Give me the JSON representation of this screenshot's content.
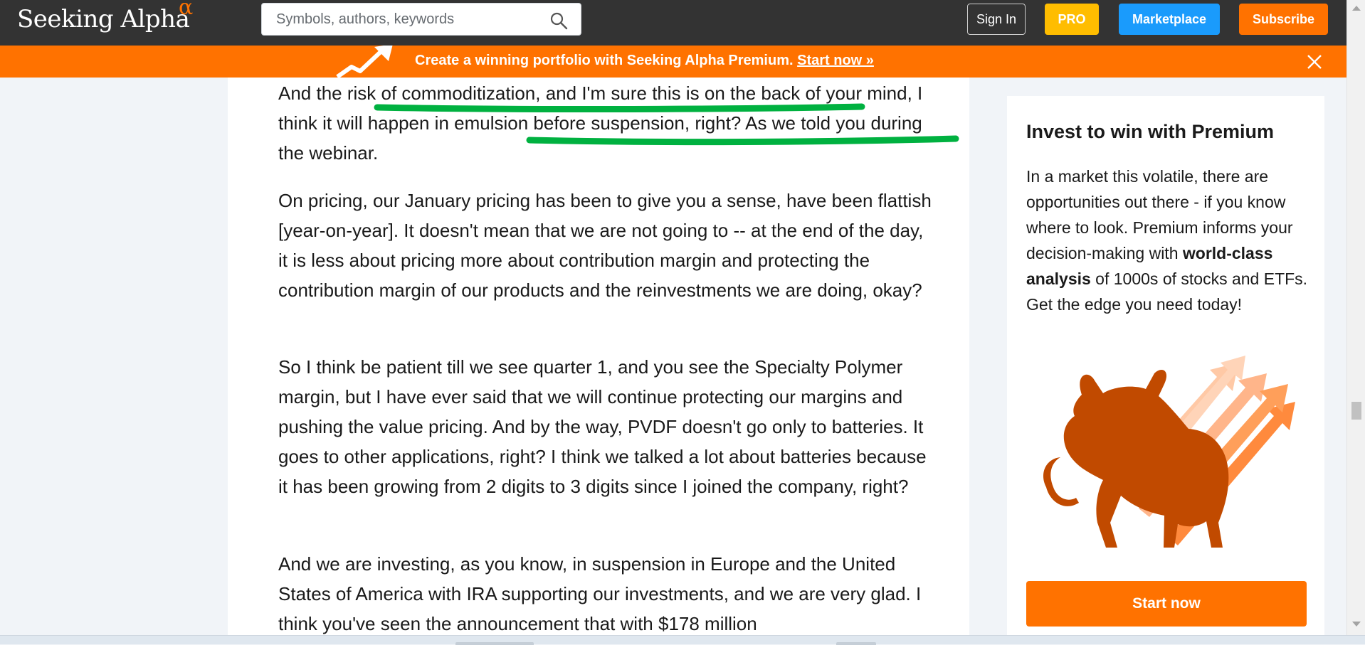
{
  "header": {
    "logo_text": "Seeking Alpha",
    "logo_symbol": "α",
    "search_placeholder": "Symbols, authors, keywords",
    "signin_label": "Sign In",
    "pro_label": "PRO",
    "marketplace_label": "Marketplace",
    "subscribe_label": "Subscribe"
  },
  "banner": {
    "text": "Create a winning portfolio with Seeking Alpha Premium.",
    "link_label": "Start now »"
  },
  "article": {
    "paragraphs": [
      "And the risk of commoditization, and I'm sure this is on the back of your mind, I think it will happen in emulsion before suspension, right? As we told you during the webinar.",
      "On pricing, our January pricing has been to give you a sense, have been flattish [year-on-year]. It doesn't mean that we are not going to -- at the end of the day, it is less about pricing more about contribution margin and protecting the contribution margin of our products and the reinvestments we are doing, okay?",
      "So I think be patient till we see quarter 1, and you see the Specialty Polymer margin, but I have ever said that we will continue protecting our margins and pushing the value pricing. And by the way, PVDF doesn't go only to batteries. It goes to other applications, right? I think we talked a lot about batteries because it has been growing from 2 digits to 3 digits since I joined the company, right?",
      "And we are investing, as you know, in suspension in Europe and the United States of America with IRA supporting our investments, and we are very glad. I think you've seen the announcement that with $178 million"
    ]
  },
  "sidebar": {
    "title": "Invest to win with Premium",
    "body_part1": "In a market this volatile, there are opportunities out there - if you know where to look. Premium informs your decision-making with ",
    "body_bold": "world-class analysis",
    "body_part2": " of 1000s of stocks and ETFs. Get the edge you need today!",
    "button_label": "Start now"
  },
  "colors": {
    "brand_orange": "#ff7200",
    "pro_yellow": "#ffbd00",
    "marketplace_blue": "#1a9bfc",
    "topbar_dark": "#333333",
    "highlight_green": "#00b140"
  },
  "icons": {
    "search": "search-icon",
    "close": "close-icon",
    "banner_graphic": "rising-arrow-icon",
    "sidebar_graphic": "bull-icon"
  }
}
